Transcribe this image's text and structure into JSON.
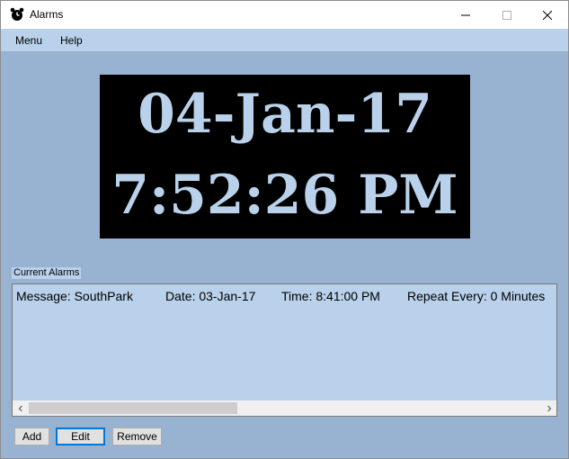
{
  "window": {
    "title": "Alarms",
    "minimize_icon": "minimize-icon",
    "maximize_icon": "maximize-icon",
    "close_icon": "close-icon"
  },
  "menu": {
    "items": [
      {
        "label": "Menu"
      },
      {
        "label": "Help"
      }
    ]
  },
  "clock": {
    "date": "04-Jan-17",
    "time": "7:52:26 PM"
  },
  "alarms": {
    "group_label": "Current Alarms",
    "rows": [
      {
        "message": "Message: SouthPark",
        "date": "Date: 03-Jan-17",
        "time": "Time: 8:41:00 PM",
        "repeat": "Repeat Every: 0 Minutes"
      }
    ]
  },
  "buttons": {
    "add": "Add",
    "edit": "Edit",
    "remove": "Remove"
  },
  "colors": {
    "background": "#98b2d2",
    "accent": "#b9d1ea",
    "clock_bg": "#000000",
    "focus": "#0078d7"
  }
}
